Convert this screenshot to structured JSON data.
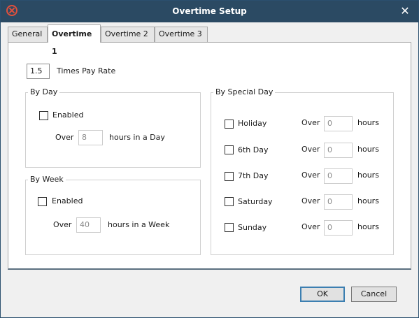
{
  "window": {
    "title": "Overtime Setup",
    "close_glyph": "✕"
  },
  "tabs": [
    {
      "label": "General",
      "active": false
    },
    {
      "label": "Overtime 1",
      "active": true
    },
    {
      "label": "Overtime 2",
      "active": false
    },
    {
      "label": "Overtime 3",
      "active": false
    }
  ],
  "pay_rate": {
    "value": "1.5",
    "label": "Times Pay Rate"
  },
  "by_day": {
    "title": "By Day",
    "enabled_label": "Enabled",
    "enabled": false,
    "over_label": "Over",
    "hours": "8",
    "suffix": "hours in a Day"
  },
  "by_week": {
    "title": "By Week",
    "enabled_label": "Enabled",
    "enabled": false,
    "over_label": "Over",
    "hours": "40",
    "suffix": "hours in a Week"
  },
  "by_special_day": {
    "title": "By Special Day",
    "over_label": "Over",
    "hours_label": "hours",
    "rows": [
      {
        "label": "Holiday",
        "checked": false,
        "value": "0"
      },
      {
        "label": "6th Day",
        "checked": false,
        "value": "0"
      },
      {
        "label": "7th Day",
        "checked": false,
        "value": "0"
      },
      {
        "label": "Saturday",
        "checked": false,
        "value": "0"
      },
      {
        "label": "Sunday",
        "checked": false,
        "value": "0"
      }
    ]
  },
  "buttons": {
    "ok": "OK",
    "cancel": "Cancel"
  },
  "colors": {
    "titlebar": "#2b4a63",
    "icon_accent": "#e0503d",
    "default_button_border": "#3c7fb1"
  }
}
